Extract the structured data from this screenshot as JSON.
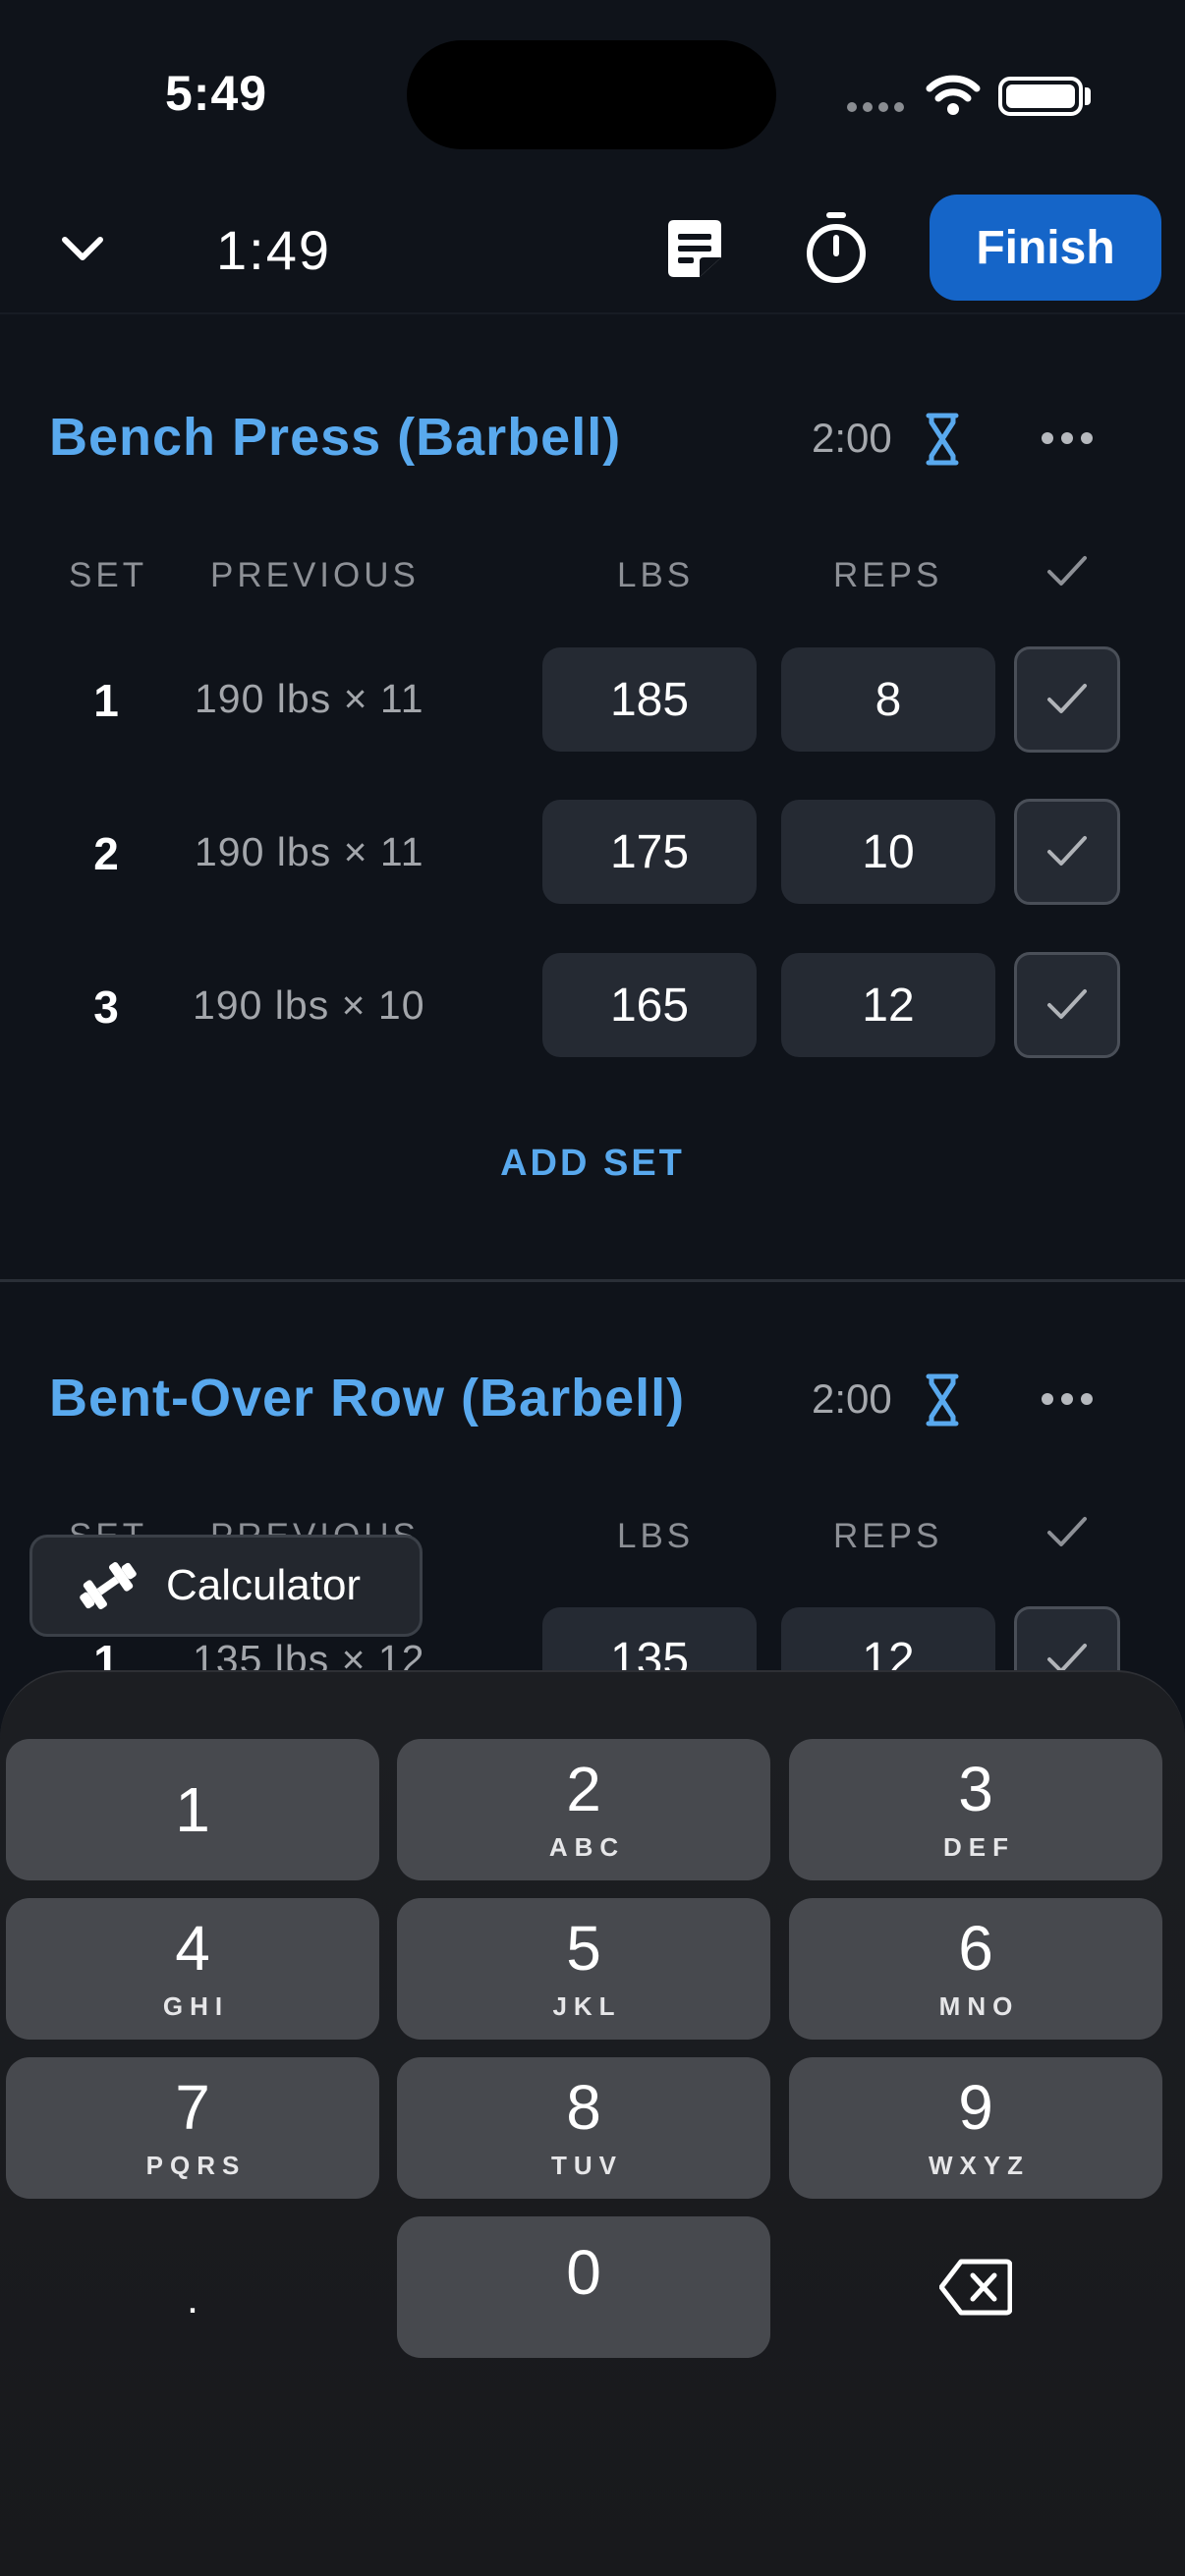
{
  "status_bar": {
    "time": "5:49"
  },
  "header": {
    "elapsed": "1:49",
    "finish_label": "Finish"
  },
  "columns": {
    "set": "SET",
    "previous": "PREVIOUS",
    "lbs": "LBS",
    "reps": "REPS"
  },
  "exercises": [
    {
      "title": "Bench Press (Barbell)",
      "rest": "2:00",
      "sets": [
        {
          "num": "1",
          "previous": "190 lbs × 11",
          "lbs": "185",
          "reps": "8"
        },
        {
          "num": "2",
          "previous": "190 lbs × 11",
          "lbs": "175",
          "reps": "10"
        },
        {
          "num": "3",
          "previous": "190 lbs × 10",
          "lbs": "165",
          "reps": "12"
        }
      ],
      "add_set": "ADD SET"
    },
    {
      "title": "Bent-Over Row (Barbell)",
      "rest": "2:00",
      "sets": [
        {
          "num": "1",
          "previous": "135 lbs × 12",
          "lbs": "135",
          "reps": "12"
        }
      ]
    }
  ],
  "calculator_chip": {
    "label": "Calculator"
  },
  "keypad": {
    "keys": [
      {
        "num": "1",
        "letters": ""
      },
      {
        "num": "2",
        "letters": "ABC"
      },
      {
        "num": "3",
        "letters": "DEF"
      },
      {
        "num": "4",
        "letters": "GHI"
      },
      {
        "num": "5",
        "letters": "JKL"
      },
      {
        "num": "6",
        "letters": "MNO"
      },
      {
        "num": "7",
        "letters": "PQRS"
      },
      {
        "num": "8",
        "letters": "TUV"
      },
      {
        "num": "9",
        "letters": "WXYZ"
      },
      {
        "num": ".",
        "letters": ""
      },
      {
        "num": "0",
        "letters": ""
      }
    ]
  },
  "colors": {
    "accent": "#59a9ee",
    "finish_button": "#1565c8",
    "background": "#0f131a"
  }
}
